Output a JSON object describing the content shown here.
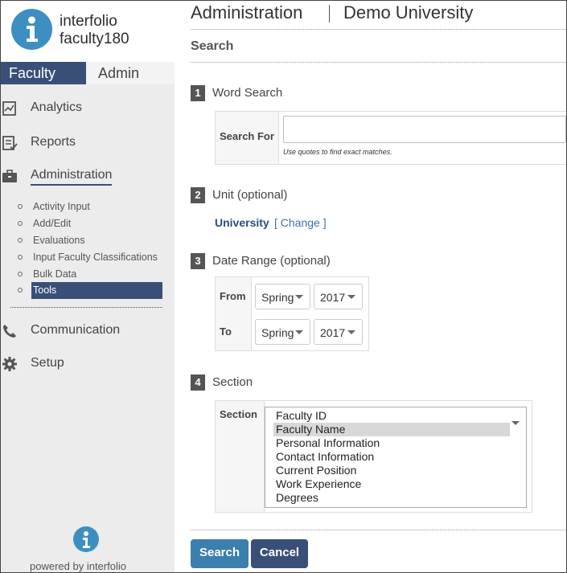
{
  "brand": {
    "line1": "interfolio",
    "line2": "faculty180",
    "logo_icon": "info-icon",
    "color": "#3d8fc1"
  },
  "tabs": [
    {
      "label": "Faculty",
      "active": true
    },
    {
      "label": "Admin",
      "active": false
    }
  ],
  "nav": {
    "analytics": {
      "label": "Analytics",
      "icon": "analytics-icon"
    },
    "reports": {
      "label": "Reports",
      "icon": "reports-icon"
    },
    "administration": {
      "label": "Administration",
      "icon": "briefcase-icon",
      "active": true
    },
    "sub_items": [
      {
        "label": "Activity Input"
      },
      {
        "label": "Add/Edit"
      },
      {
        "label": "Evaluations"
      },
      {
        "label": "Input Faculty Classifications"
      },
      {
        "label": "Bulk Data"
      },
      {
        "label": "Tools",
        "selected": true
      }
    ],
    "communication": {
      "label": "Communication",
      "icon": "phone-icon"
    },
    "setup": {
      "label": "Setup",
      "icon": "gear-icon"
    }
  },
  "powered_by": "powered by interfolio",
  "header": {
    "title": "Administration",
    "institution": "Demo University"
  },
  "page_heading": "Search",
  "word_search": {
    "step": "1",
    "title": "Word Search",
    "field_label": "Search For",
    "value": "",
    "hint": "Use quotes to find exact matches."
  },
  "unit": {
    "step": "2",
    "title": "Unit (optional)",
    "value": "University",
    "change_link": "[ Change ]"
  },
  "date_range": {
    "step": "3",
    "title": "Date Range (optional)",
    "from_label": "From",
    "to_label": "To",
    "from_term": "Spring",
    "from_year": "2017",
    "to_term": "Spring",
    "to_year": "2017"
  },
  "section": {
    "step": "4",
    "title": "Section",
    "field_label": "Section",
    "options": [
      {
        "label": "Faculty ID",
        "selected": false
      },
      {
        "label": "Faculty Name",
        "selected": true
      },
      {
        "label": "Personal Information",
        "selected": false
      },
      {
        "label": "Contact Information",
        "selected": false
      },
      {
        "label": "Current Position",
        "selected": false
      },
      {
        "label": "Work Experience",
        "selected": false
      },
      {
        "label": "Degrees",
        "selected": false
      }
    ]
  },
  "buttons": {
    "search": "Search",
    "cancel": "Cancel"
  },
  "colors": {
    "primary_nav": "#3a4f78",
    "button_search": "#3b7fae",
    "link": "#3d72b0"
  }
}
